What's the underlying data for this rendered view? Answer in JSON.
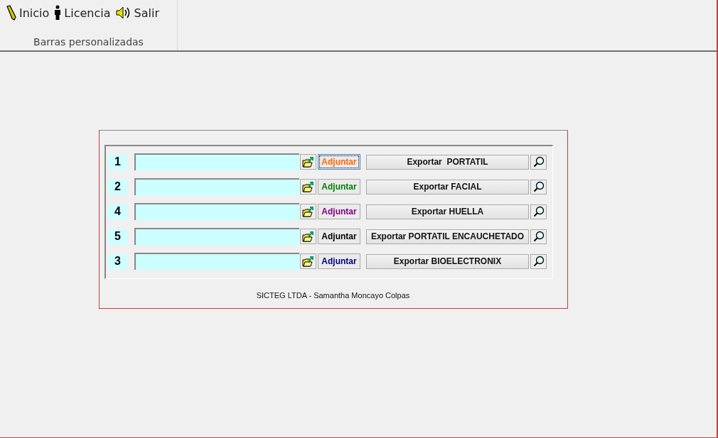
{
  "toolbar": {
    "buttons": [
      {
        "kind": "pencil",
        "label": "Inicio"
      },
      {
        "kind": "person",
        "label": "Licencia"
      },
      {
        "kind": "speaker",
        "label": "Salir"
      }
    ],
    "group_label": "Barras personalizadas"
  },
  "rows": [
    {
      "number": "1",
      "attach_label": "Adjuntar",
      "color": "#ff6a00",
      "focused": true,
      "export_label": "Exportar  PORTATIL"
    },
    {
      "number": "2",
      "attach_label": "Adjuntar",
      "color": "#008000",
      "focused": false,
      "export_label": "Exportar FACIAL"
    },
    {
      "number": "4",
      "attach_label": "Adjuntar",
      "color": "#800080",
      "focused": false,
      "export_label": "Exportar HUELLA"
    },
    {
      "number": "5",
      "attach_label": "Adjuntar",
      "color": "#000000",
      "focused": false,
      "export_label": "Exportar PORTATIL ENCAUCHETADO"
    },
    {
      "number": "3",
      "attach_label": "Adjuntar",
      "color": "#000080",
      "focused": false,
      "export_label": "Exportar BIOELECTRONIX"
    }
  ],
  "footer": "SICTEG LTDA - Samantha Moncayo Colpas"
}
